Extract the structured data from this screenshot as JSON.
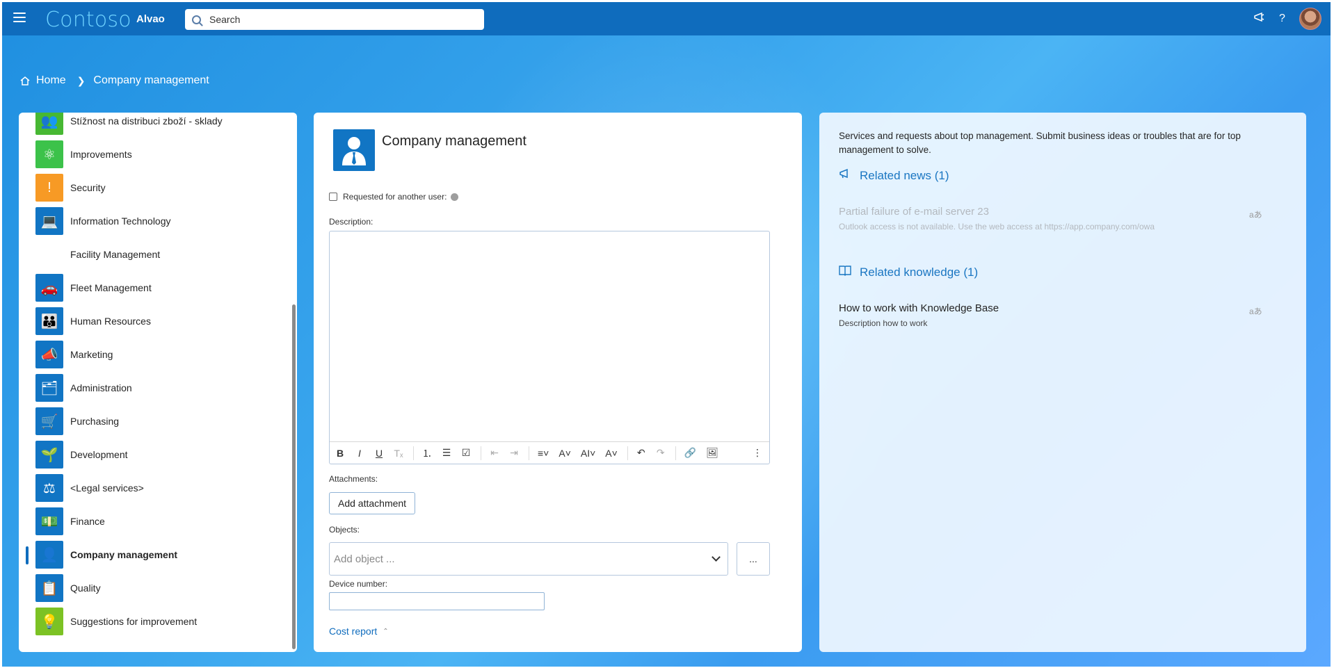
{
  "topbar": {
    "brand": "Contoso",
    "product": "Alvao",
    "search_placeholder": "Search",
    "icons": [
      "menu-icon",
      "search-icon",
      "announcement-icon",
      "help-icon",
      "avatar"
    ]
  },
  "breadcrumb": {
    "home": "Home",
    "current": "Company management"
  },
  "sidebar": {
    "items": [
      {
        "label": "Stížnost na distribuci zboží - sklady",
        "icon": "people-icon",
        "color": "#47b833",
        "glyph": "👥"
      },
      {
        "label": "Improvements",
        "icon": "atom-icon",
        "color": "#3cc24a",
        "glyph": "⚛"
      },
      {
        "label": "Security",
        "icon": "shield-icon",
        "color": "#f79a25",
        "glyph": "!"
      },
      {
        "label": "Information Technology",
        "icon": "desk-icon",
        "color": "#1175c4",
        "glyph": "💻"
      },
      {
        "label": "Facility Management",
        "icon": "",
        "color": "#ffffff",
        "glyph": ""
      },
      {
        "label": "Fleet Management",
        "icon": "car-icon",
        "color": "#1175c4",
        "glyph": "🚗"
      },
      {
        "label": "Human Resources",
        "icon": "group-icon",
        "color": "#1175c4",
        "glyph": "👪"
      },
      {
        "label": "Marketing",
        "icon": "megaphone-icon",
        "color": "#1175c4",
        "glyph": "📣"
      },
      {
        "label": "Administration",
        "icon": "binders-icon",
        "color": "#1175c4",
        "glyph": "🗂"
      },
      {
        "label": "Purchasing",
        "icon": "cart-icon",
        "color": "#1175c4",
        "glyph": "🛒"
      },
      {
        "label": "Development",
        "icon": "plant-hand-icon",
        "color": "#1175c4",
        "glyph": "🌱"
      },
      {
        "label": "<Legal services>",
        "icon": "scales-icon",
        "color": "#1175c4",
        "glyph": "⚖"
      },
      {
        "label": "Finance",
        "icon": "money-icon",
        "color": "#1175c4",
        "glyph": "💵"
      },
      {
        "label": "Company management",
        "icon": "manager-icon",
        "color": "#1175c4",
        "glyph": "👤",
        "active": true
      },
      {
        "label": "Quality",
        "icon": "certificate-icon",
        "color": "#1175c4",
        "glyph": "📋"
      },
      {
        "label": "Suggestions for improvement",
        "icon": "lightbulb-icon",
        "color": "#7cc224",
        "glyph": "💡"
      }
    ]
  },
  "form": {
    "title": "Company management",
    "requested_for_other": "Requested for another user:",
    "description_label": "Description:",
    "attachments_label": "Attachments:",
    "add_attachment": "Add attachment",
    "objects_label": "Objects:",
    "add_object_placeholder": "Add object ...",
    "more_button": "...",
    "device_number_label": "Device number:",
    "cost_report": "Cost report"
  },
  "toolbar": {
    "buttons": [
      {
        "name": "bold-icon",
        "glyph": "B"
      },
      {
        "name": "italic-icon",
        "glyph": "I"
      },
      {
        "name": "underline-icon",
        "glyph": "U"
      },
      {
        "name": "clear-format-icon",
        "glyph": "Tₓ"
      },
      {
        "name": "numbered-list-icon",
        "glyph": "⒈"
      },
      {
        "name": "bullet-list-icon",
        "glyph": "☰"
      },
      {
        "name": "checklist-icon",
        "glyph": "☑"
      },
      {
        "name": "outdent-icon",
        "glyph": "⇤"
      },
      {
        "name": "indent-icon",
        "glyph": "⇥"
      },
      {
        "name": "align-icon",
        "glyph": "≡˅"
      },
      {
        "name": "font-size-icon",
        "glyph": "A˅"
      },
      {
        "name": "font-icon",
        "glyph": "AI˅"
      },
      {
        "name": "font-color-icon",
        "glyph": "A˅"
      },
      {
        "name": "undo-icon",
        "glyph": "↶"
      },
      {
        "name": "redo-icon",
        "glyph": "↷"
      },
      {
        "name": "link-icon",
        "glyph": "🔗"
      },
      {
        "name": "insert-image-icon",
        "glyph": "🖼"
      },
      {
        "name": "more-vertical-icon",
        "glyph": "⋮"
      }
    ]
  },
  "info": {
    "description": "Services and requests about top management. Submit business ideas or troubles that are for top management to solve.",
    "news_heading": "Related news (1)",
    "news_items": [
      {
        "title": "Partial failure of e-mail server 23",
        "subtitle": "Outlook access is not available. Use the web access at https://app.company.com/owa"
      }
    ],
    "knowledge_heading": "Related knowledge (1)",
    "knowledge_items": [
      {
        "title": "How to work with Knowledge Base",
        "subtitle": "Description how to work"
      }
    ],
    "translate_glyph": "aあ"
  }
}
